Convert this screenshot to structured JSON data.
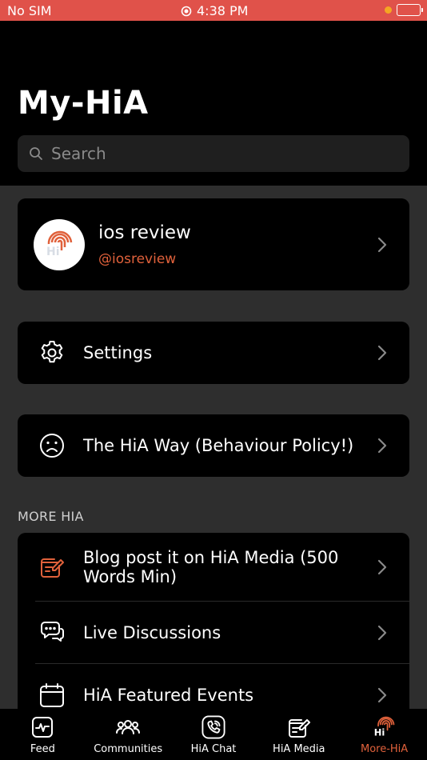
{
  "status_bar": {
    "carrier": "No SIM",
    "time": "4:38 PM"
  },
  "header": {
    "title": "My-HiA"
  },
  "search": {
    "placeholder": "Search"
  },
  "profile": {
    "name": "ios review",
    "handle": "@iosreview",
    "avatar_logo_text": "Hi"
  },
  "settings": {
    "label": "Settings"
  },
  "policy": {
    "label": "The HiA Way (Behaviour Policy!)"
  },
  "more_section": {
    "title": "MORE HIA",
    "items": [
      {
        "label": "Blog post it on HiA Media (500 Words Min)",
        "icon": "edit-note-icon"
      },
      {
        "label": "Live Discussions",
        "icon": "chat-bubbles-icon"
      },
      {
        "label": "HiA Featured Events",
        "icon": "calendar-icon"
      }
    ]
  },
  "tabbar": {
    "tabs": [
      {
        "label": "Feed",
        "icon": "activity-icon"
      },
      {
        "label": "Communities",
        "icon": "people-icon"
      },
      {
        "label": "HiA Chat",
        "icon": "phone-icon"
      },
      {
        "label": "HiA Media",
        "icon": "note-edit-icon"
      },
      {
        "label": "More-HiA",
        "icon": "hia-logo-icon",
        "active": true
      }
    ]
  },
  "colors": {
    "accent": "#e0613b",
    "status_bar": "#e0524a",
    "card": "#000000",
    "background": "#2e2e2e"
  }
}
